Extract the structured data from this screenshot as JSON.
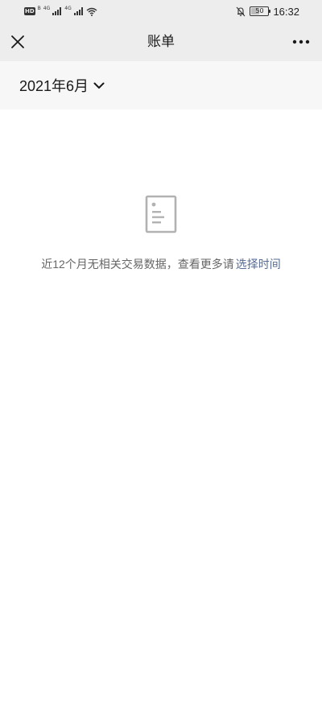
{
  "status_bar": {
    "network_badge": "HD",
    "network_sub": "B",
    "signal_1_label": "4G",
    "signal_2_label": "4G",
    "battery_level": "50",
    "battery_fraction": 0.5,
    "time": "16:32",
    "icons": [
      "signal-icon",
      "signal-icon",
      "wifi-icon",
      "mute-bell-icon",
      "battery-icon"
    ]
  },
  "header": {
    "title": "账单",
    "close_icon": "close-icon",
    "more_icon": "more-icon"
  },
  "month_selector": {
    "label": "2021年6月",
    "icon": "chevron-down-icon"
  },
  "empty_state": {
    "icon": "document-icon",
    "message": "近12个月无相关交易数据，查看更多请",
    "link_label": "选择时间"
  },
  "colors": {
    "header_bg": "#ededed",
    "month_bar_bg": "#f7f7f7",
    "body_bg": "#ffffff",
    "link": "#576b95",
    "muted_text": "#666666",
    "icon_grey": "#b2b2b2"
  }
}
